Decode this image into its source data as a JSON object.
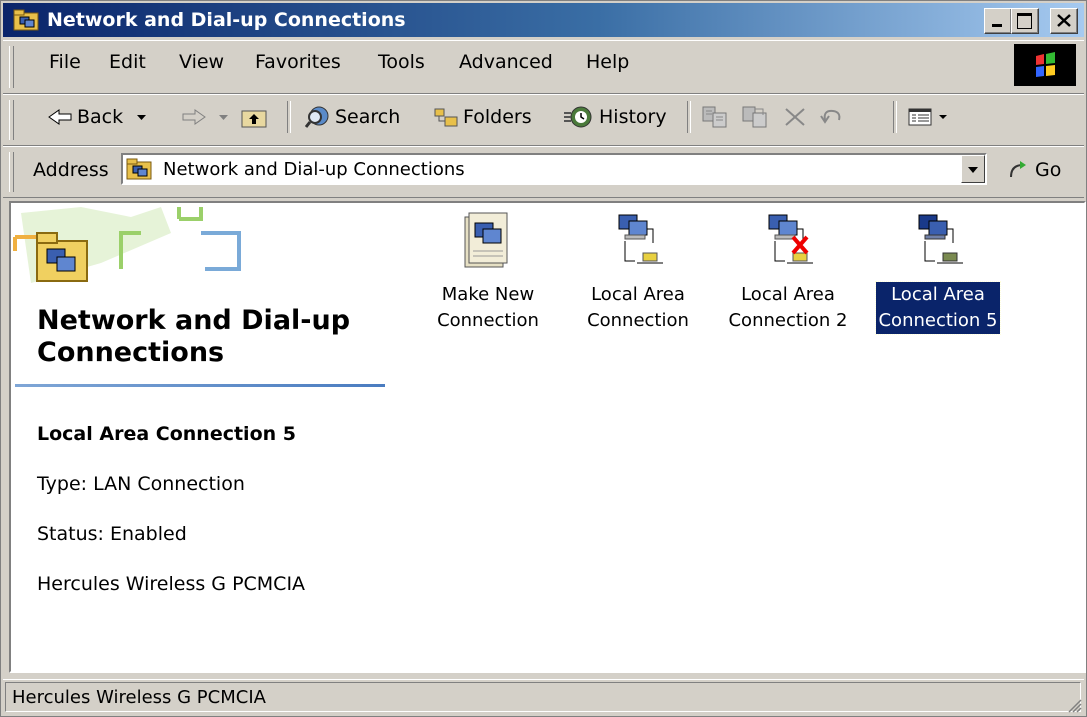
{
  "window": {
    "title": "Network and Dial-up Connections"
  },
  "menu": {
    "items": [
      {
        "label": "File"
      },
      {
        "label": "Edit"
      },
      {
        "label": "View"
      },
      {
        "label": "Favorites"
      },
      {
        "label": "Tools"
      },
      {
        "label": "Advanced"
      },
      {
        "label": "Help"
      }
    ]
  },
  "toolbar": {
    "back": "Back",
    "search": "Search",
    "folders": "Folders",
    "history": "History"
  },
  "address": {
    "label": "Address",
    "value": "Network and Dial-up Connections",
    "go": "Go"
  },
  "sidebar": {
    "title": "Network and Dial-up Connections",
    "selected_name": "Local Area Connection 5",
    "type": "Type: LAN Connection",
    "status": "Status: Enabled",
    "device": "Hercules Wireless G PCMCIA"
  },
  "icons": [
    {
      "line1": "Make New",
      "line2": "Connection",
      "icon": "make-new-connection-icon"
    },
    {
      "line1": "Local Area",
      "line2": "Connection",
      "icon": "lan-connection-icon"
    },
    {
      "line1": "Local Area",
      "line2": "Connection 2",
      "icon": "lan-disconnected-icon"
    },
    {
      "line1": "Local Area",
      "line2": "Connection 5",
      "icon": "lan-connection-icon",
      "selected": true
    }
  ],
  "statusbar": {
    "text": "Hercules Wireless G PCMCIA"
  },
  "colors": {
    "title_bar": "#0a246a",
    "selection": "#0a246a",
    "face": "#d4d0c8"
  }
}
